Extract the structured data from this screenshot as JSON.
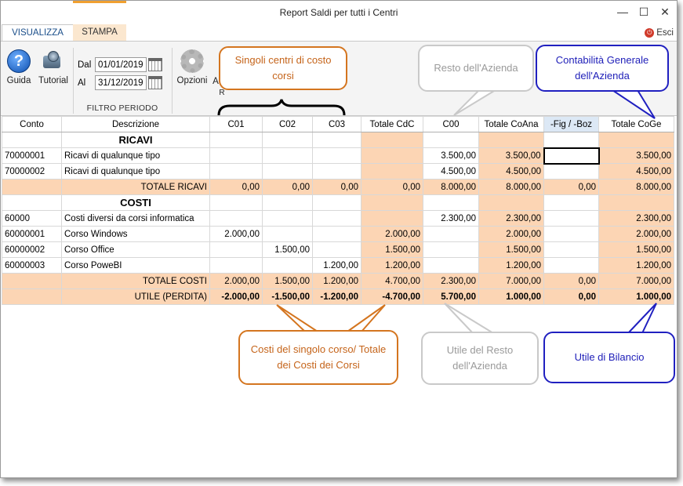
{
  "window": {
    "title": "Report Saldi per tutti i Centri"
  },
  "tabs": {
    "visualizza": "VISUALIZZA",
    "stampa": "STAMPA",
    "esci": "Esci"
  },
  "ribbon": {
    "guida": "Guida",
    "tutorial": "Tutorial",
    "dal_label": "Dal",
    "al_label": "Al",
    "dal_value": "01/01/2019",
    "al_value": "31/12/2019",
    "filtro_periodo": "FILTRO PERIODO",
    "opzioni": "Opzioni",
    "partial_a": "A",
    "partial_r": "R"
  },
  "table": {
    "headers": [
      "Conto",
      "Descrizione",
      "C01",
      "C02",
      "C03",
      "Totale CdC",
      "C00",
      "Totale CoAna",
      "-Fig / -Boz",
      "Totale CoGe"
    ],
    "ricavi_title": "RICAVI",
    "costi_title": "COSTI",
    "ricavi_rows": [
      [
        "70000001",
        "Ricavi di qualunque tipo",
        "",
        "",
        "",
        "",
        "3.500,00",
        "3.500,00",
        "",
        "3.500,00"
      ],
      [
        "70000002",
        "Ricavi di qualunque tipo",
        "",
        "",
        "",
        "",
        "4.500,00",
        "4.500,00",
        "",
        "4.500,00"
      ]
    ],
    "totale_ricavi": [
      "",
      "TOTALE RICAVI",
      "0,00",
      "0,00",
      "0,00",
      "0,00",
      "8.000,00",
      "8.000,00",
      "0,00",
      "8.000,00"
    ],
    "costi_rows": [
      [
        "60000",
        "Costi diversi da corsi informatica",
        "",
        "",
        "",
        "",
        "2.300,00",
        "2.300,00",
        "",
        "2.300,00"
      ],
      [
        "60000001",
        "Corso Windows",
        "2.000,00",
        "",
        "",
        "2.000,00",
        "",
        "2.000,00",
        "",
        "2.000,00"
      ],
      [
        "60000002",
        "Corso Office",
        "",
        "1.500,00",
        "",
        "1.500,00",
        "",
        "1.500,00",
        "",
        "1.500,00"
      ],
      [
        "60000003",
        "Corso PoweBI",
        "",
        "",
        "1.200,00",
        "1.200,00",
        "",
        "1.200,00",
        "",
        "1.200,00"
      ]
    ],
    "totale_costi": [
      "",
      "TOTALE COSTI",
      "2.000,00",
      "1.500,00",
      "1.200,00",
      "4.700,00",
      "2.300,00",
      "7.000,00",
      "0,00",
      "7.000,00"
    ],
    "utile": [
      "",
      "UTILE (PERDITA)",
      "-2.000,00",
      "-1.500,00",
      "-1.200,00",
      "-4.700,00",
      "5.700,00",
      "1.000,00",
      "0,00",
      "1.000,00"
    ]
  },
  "callouts": {
    "singoli": "Singoli centri di costo corsi",
    "resto": "Resto dell'Azienda",
    "contabilita": "Contabilità Generale dell'Azienda",
    "costi_corso": "Costi del singolo corso/ Totale dei Costi dei Corsi",
    "utile_resto": "Utile del Resto dell'Azienda",
    "utile_bilancio": "Utile di Bilancio"
  },
  "colors": {
    "peach": "#fcd5b4",
    "orange": "#d4751f",
    "blue": "#2020c0",
    "grey": "#c9c9c9"
  }
}
